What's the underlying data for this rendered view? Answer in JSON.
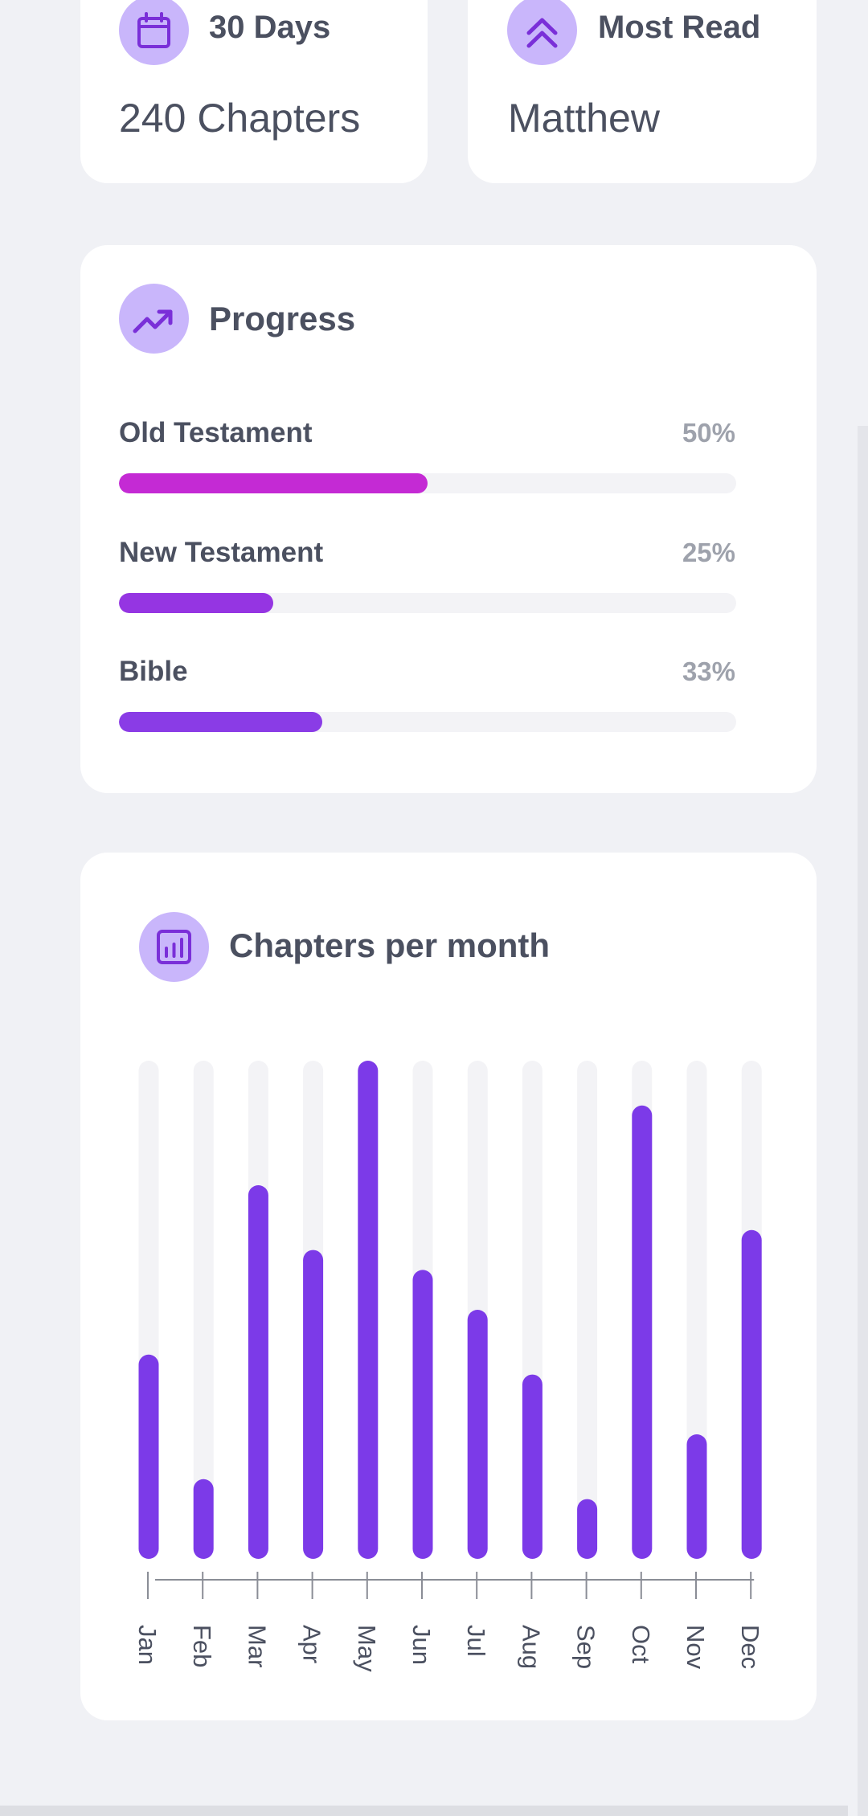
{
  "stats": [
    {
      "icon": "calendar-icon",
      "title": "30 Days",
      "value": "240 Chapters"
    },
    {
      "icon": "chevrons-up-icon",
      "title": "Most Read",
      "value": "Matthew"
    }
  ],
  "progress": {
    "title": "Progress",
    "icon": "trending-up-icon",
    "items": [
      {
        "label": "Old Testament",
        "percent_text": "50%",
        "value": 0.5,
        "color": "#c42ad4"
      },
      {
        "label": "New Testament",
        "percent_text": "25%",
        "value": 0.25,
        "color": "#9535e2"
      },
      {
        "label": "Bible",
        "percent_text": "33%",
        "value": 0.33,
        "color": "#8a3ce6"
      }
    ]
  },
  "chart_section": {
    "title": "Chapters per month",
    "icon": "bar-chart-icon"
  },
  "chart_data": {
    "type": "bar",
    "categories": [
      "Jan",
      "Feb",
      "Mar",
      "Apr",
      "May",
      "Jun",
      "Jul",
      "Aug",
      "Sep",
      "Oct",
      "Nov",
      "Dec"
    ],
    "values": [
      41,
      16,
      75,
      62,
      100,
      58,
      50,
      37,
      12,
      91,
      25,
      66
    ],
    "ylim": [
      0,
      100
    ],
    "title": "",
    "xlabel": "",
    "ylabel": "",
    "grid": false,
    "colors": {
      "bar": "#7c3ae8",
      "track": "#f3f3f6",
      "axis": "#8a8d96"
    }
  }
}
